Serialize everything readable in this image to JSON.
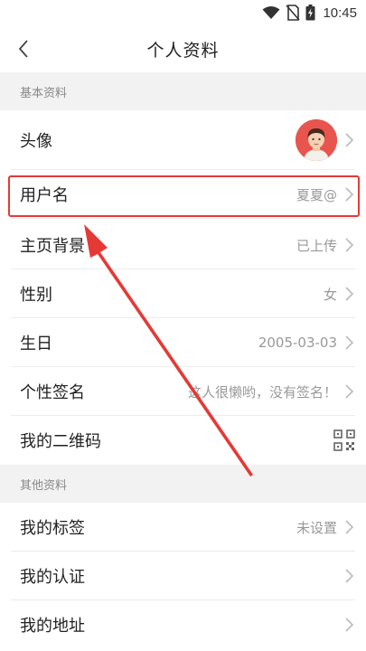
{
  "status": {
    "time": "10:45",
    "icons": [
      "wifi-icon",
      "no-sim-icon",
      "battery-charging-icon"
    ]
  },
  "nav": {
    "title": "个人资料",
    "back_icon": "chevron-left-icon"
  },
  "sections": {
    "basic": {
      "title": "基本资料"
    },
    "other": {
      "title": "其他资料"
    }
  },
  "rows": {
    "avatar": {
      "label": "头像"
    },
    "username": {
      "label": "用户名",
      "value": "夏夏@"
    },
    "cover": {
      "label": "主页背景",
      "value": "已上传"
    },
    "gender": {
      "label": "性别",
      "value": "女"
    },
    "birthday": {
      "label": "生日",
      "value": "2005-03-03"
    },
    "signature": {
      "label": "个性签名",
      "value": "这人很懒哟，没有签名！"
    },
    "qrcode": {
      "label": "我的二维码",
      "icon": "qr-code-icon"
    },
    "tags": {
      "label": "我的标签",
      "value": "未设置"
    },
    "verify": {
      "label": "我的认证"
    },
    "address": {
      "label": "我的地址"
    }
  },
  "colors": {
    "highlight": "#e53935",
    "avatar_bg": "#e8554e",
    "section_bg": "#f2f2f2"
  }
}
